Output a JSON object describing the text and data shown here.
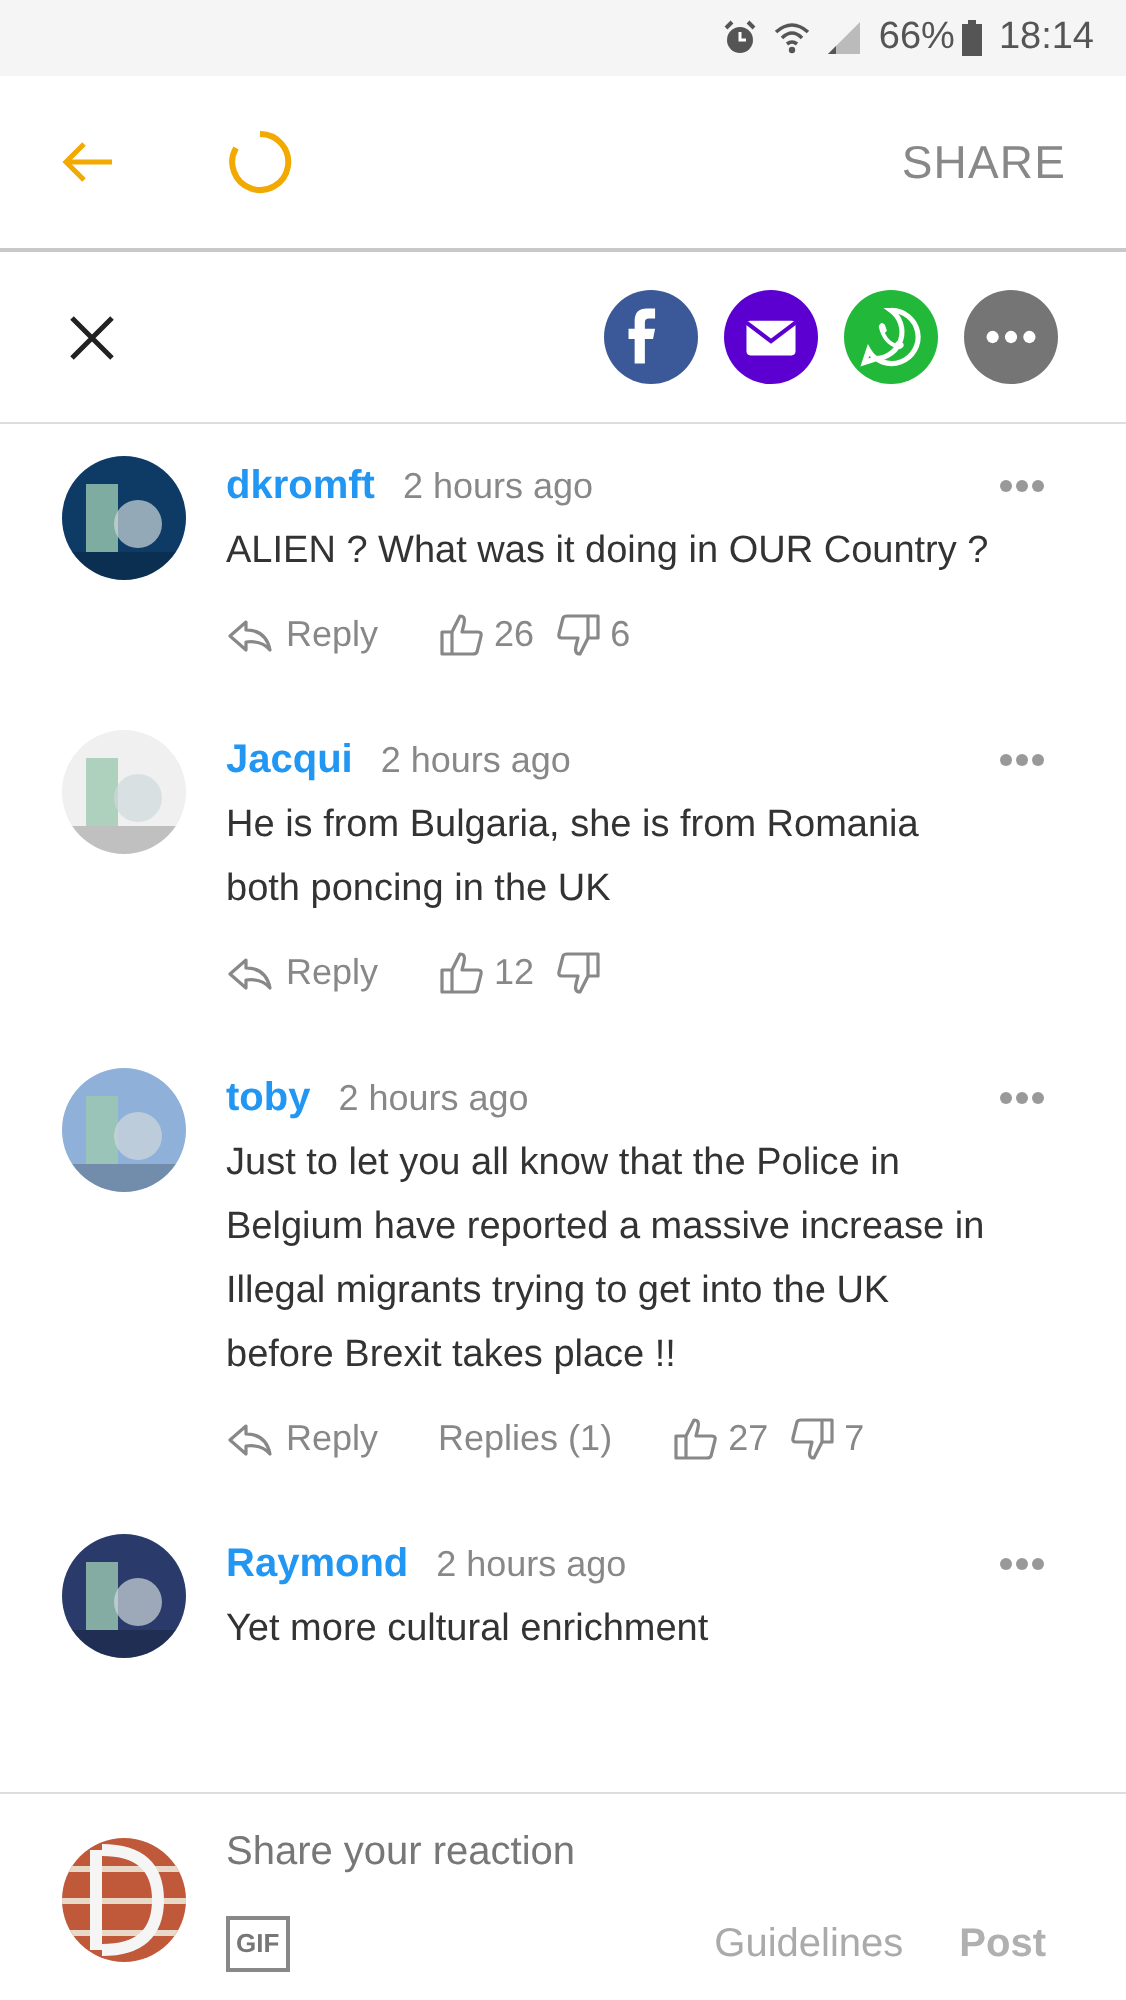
{
  "status_bar": {
    "battery": "66%",
    "time": "18:14"
  },
  "toolbar": {
    "share_label": "SHARE"
  },
  "share_buttons": [
    {
      "kind": "facebook",
      "color": "#3b5998"
    },
    {
      "kind": "email",
      "color": "#5b00d1"
    },
    {
      "kind": "whatsapp",
      "color": "#22b83a"
    },
    {
      "kind": "more",
      "color": "#757575"
    }
  ],
  "comments": [
    {
      "name": "dkromft",
      "time": "2 hours ago",
      "text": "ALIEN ? What was it doing in OUR Country ?",
      "reply": "Reply",
      "likes": "26",
      "dislikes": "6"
    },
    {
      "name": "Jacqui",
      "time": "2 hours ago",
      "text": "He is from Bulgaria, she is from Romania both poncing in the UK",
      "reply": "Reply",
      "likes": "12"
    },
    {
      "name": "toby",
      "time": "2 hours ago",
      "text": "Just to let you all know that the Police in Belgium have reported a massive increase in Illegal migrants trying to get into the UK before Brexit takes place !!",
      "reply": "Reply",
      "replies": "Replies (1)",
      "likes": "27",
      "dislikes": "7"
    },
    {
      "name": "Raymond",
      "time": "2 hours ago",
      "text": "Yet more cultural enrichment"
    }
  ],
  "composer": {
    "placeholder": "Share your reaction",
    "gif": "GIF",
    "guidelines": "Guidelines",
    "post": "Post"
  }
}
